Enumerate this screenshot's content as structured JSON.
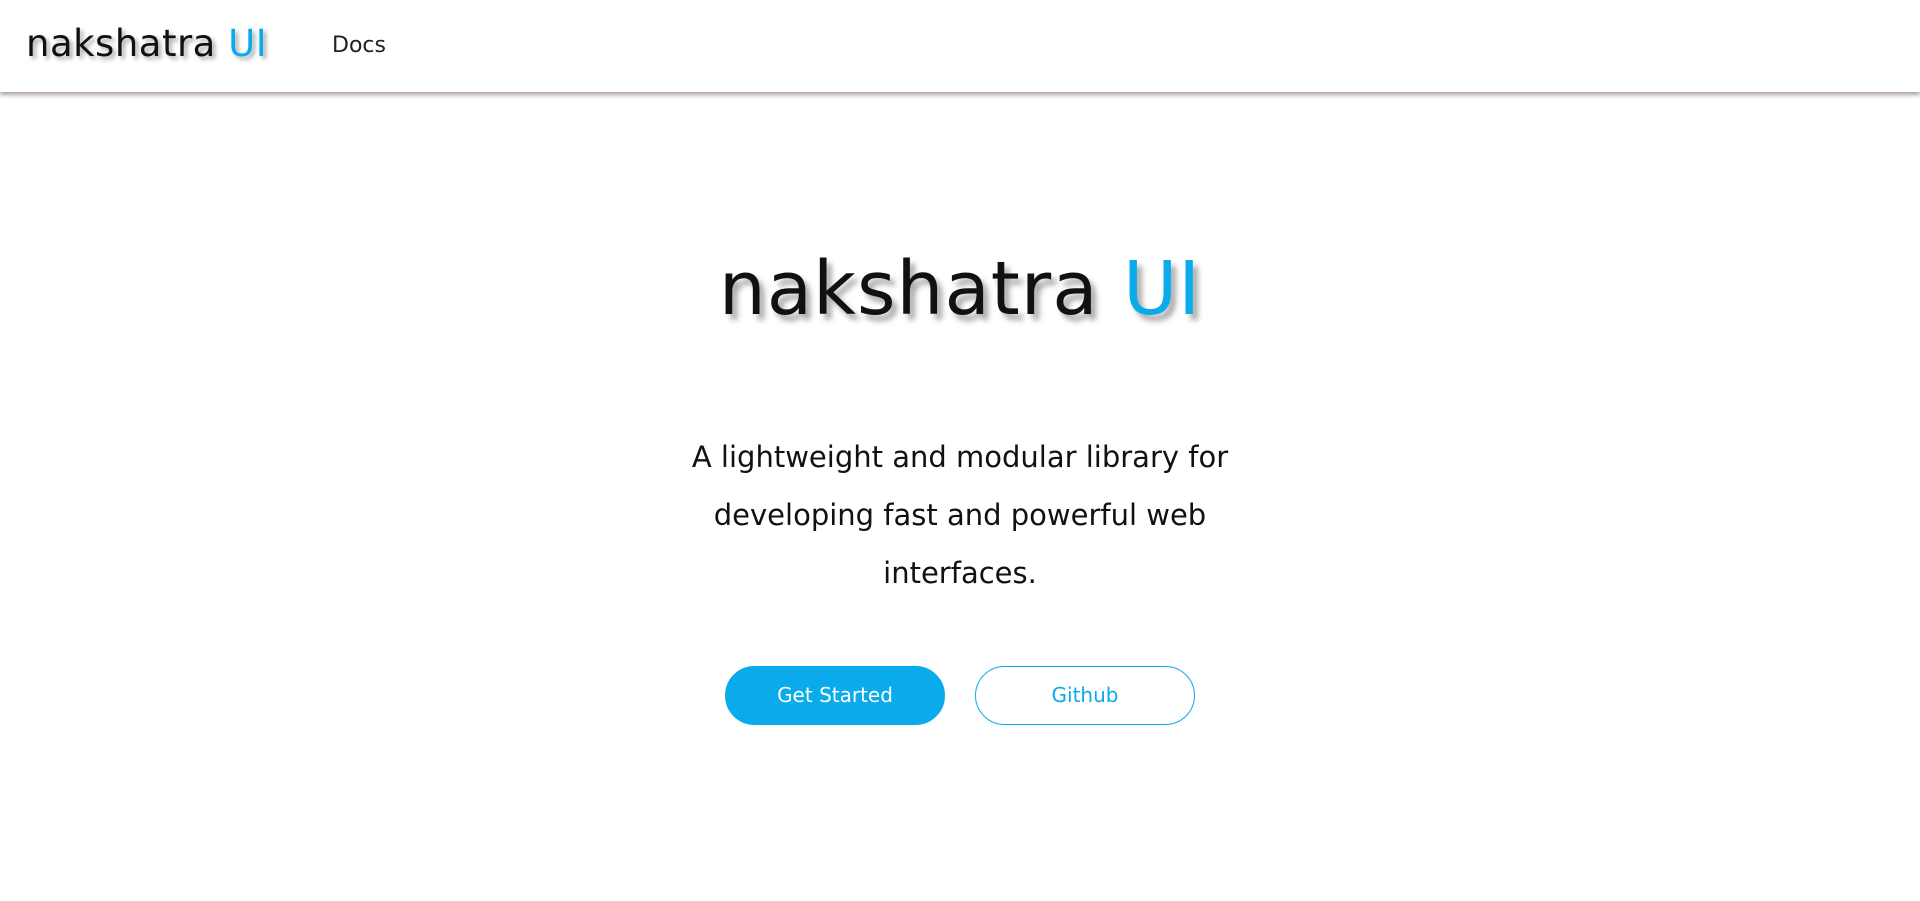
{
  "navbar": {
    "brand_main": "nakshatra",
    "brand_accent": "UI",
    "docs_label": "Docs"
  },
  "hero": {
    "title_main": "nakshatra",
    "title_accent": "UI",
    "tagline": "A lightweight and modular library for developing fast and powerful web interfaces.",
    "primary_button": "Get Started",
    "secondary_button": "Github"
  },
  "colors": {
    "accent": "#0aabeb",
    "text": "#111111",
    "background": "#ffffff"
  }
}
